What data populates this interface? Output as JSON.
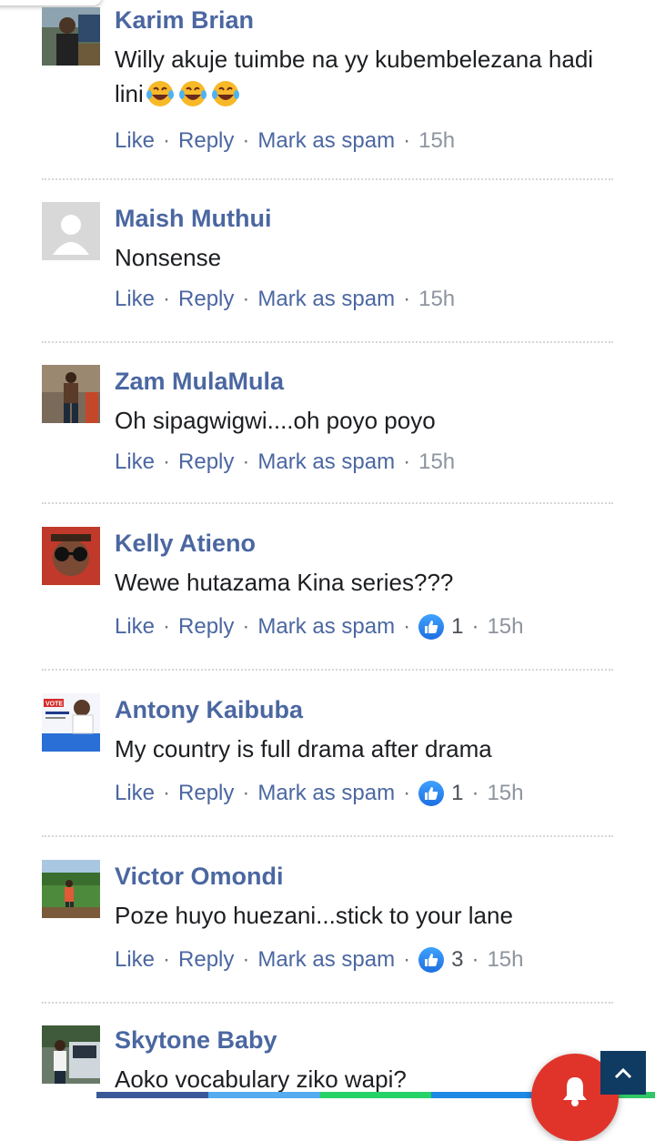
{
  "actions": {
    "like": "Like",
    "reply": "Reply",
    "mark_spam": "Mark as spam",
    "separator": "·"
  },
  "comments": [
    {
      "author": "Karim Brian",
      "text": "Willy akuje tuimbe na yy kubembelezana hadi lini",
      "emoji": [
        "laughing-tears-emoji",
        "laughing-tears-emoji",
        "laughing-tears-emoji"
      ],
      "likes": "",
      "time": "15h",
      "avatar": "photo-man-outdoor"
    },
    {
      "author": "Maish Muthui",
      "text": "Nonsense",
      "likes": "",
      "time": "15h",
      "avatar": "default-avatar"
    },
    {
      "author": "Zam MulaMula",
      "text": "Oh sipagwigwi....oh poyo poyo",
      "likes": "",
      "time": "15h",
      "avatar": "photo-man-standing"
    },
    {
      "author": "Kelly Atieno",
      "text": "Wewe hutazama Kina series???",
      "likes": "1",
      "time": "15h",
      "avatar": "photo-sunglasses"
    },
    {
      "author": "Antony Kaibuba",
      "text": "My country is full drama after drama",
      "likes": "1",
      "time": "15h",
      "avatar": "vote-poster"
    },
    {
      "author": "Victor Omondi",
      "text": "Poze huyo huezani...stick to your lane",
      "likes": "3",
      "time": "15h",
      "avatar": "photo-man-field"
    },
    {
      "author": "Skytone Baby",
      "text": "Aoko vocabulary ziko wapi?",
      "likes": "",
      "time": "",
      "avatar": "photo-man-car"
    }
  ],
  "colors": {
    "link_blue": "#4b67a1",
    "notification_red": "#e0342a",
    "scroll_top_bg": "#0f3b63",
    "share_facebook": "#3b5998",
    "share_twitter": "#55acee",
    "share_whatsapp": "#25d366",
    "share_messenger": "#1e88e5",
    "share_more": "#32c766"
  },
  "floating": {
    "scroll_top_icon": "chevron-up-icon",
    "notification_icon": "bell-icon"
  }
}
